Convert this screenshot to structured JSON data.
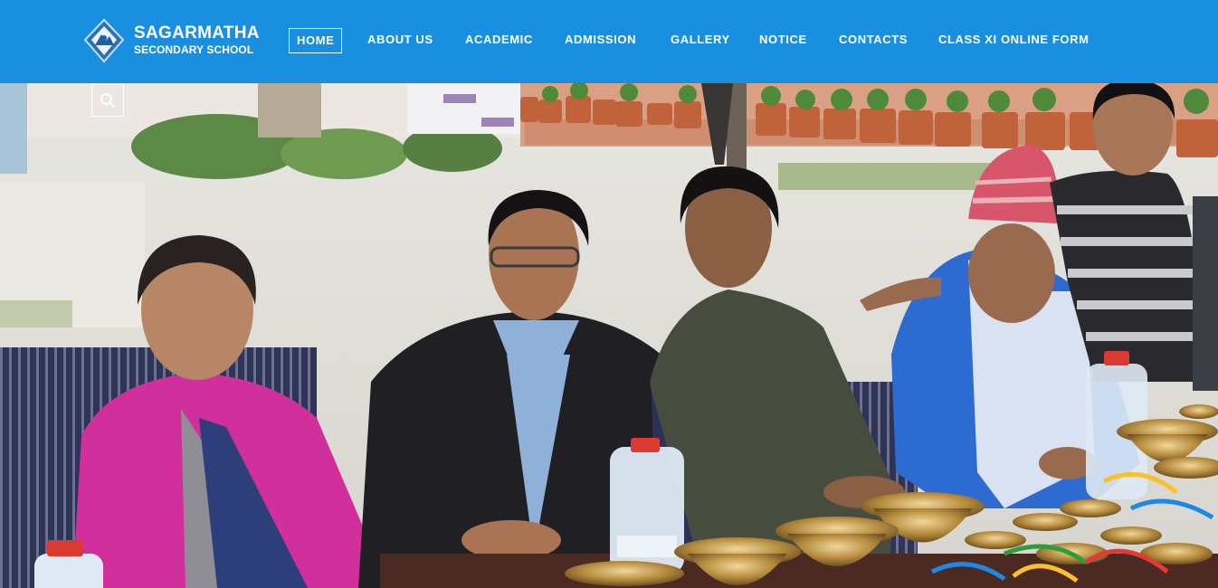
{
  "brand": {
    "name_line1": "SAGARMATHA",
    "name_line2": "SECONDARY SCHOOL"
  },
  "nav": {
    "items": [
      {
        "label": "HOME",
        "active": true
      },
      {
        "label": "ABOUT US"
      },
      {
        "label": "ACADEMIC"
      },
      {
        "label": "ADMISSION"
      },
      {
        "label": "GALLERY"
      },
      {
        "label": "NOTICE"
      },
      {
        "label": "CONTACTS"
      },
      {
        "label": "CLASS XI ONLINE FORM"
      }
    ]
  },
  "search": {
    "icon": "search-icon"
  },
  "hero": {
    "icon": "hero-photo"
  },
  "colors": {
    "header_bg": "#1a8fe0",
    "nav_text": "#ffffff"
  }
}
